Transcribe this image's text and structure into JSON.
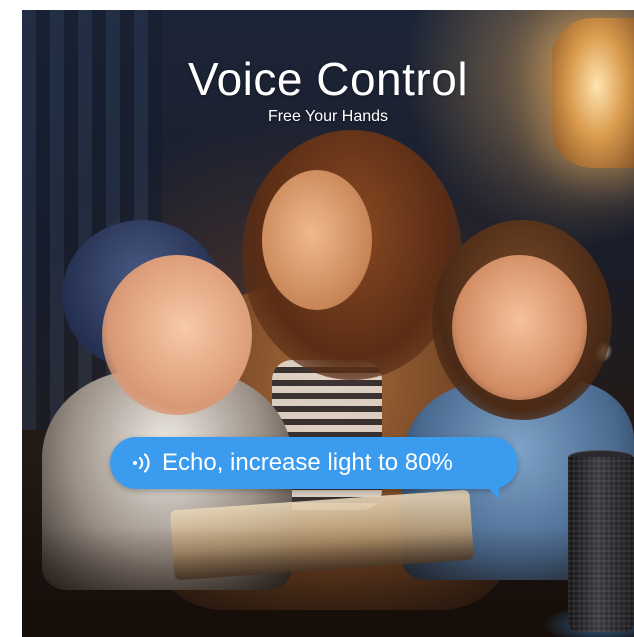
{
  "headline": {
    "title": "Voice Control",
    "subtitle": "Free Your Hands"
  },
  "speech_bubble": {
    "icon": "sound-waves-icon",
    "text": "Echo, increase light to 80%",
    "color": "#3a9bef"
  },
  "photo": {
    "subject": "mother-with-two-children-reading",
    "device": "smart-speaker-icon"
  }
}
